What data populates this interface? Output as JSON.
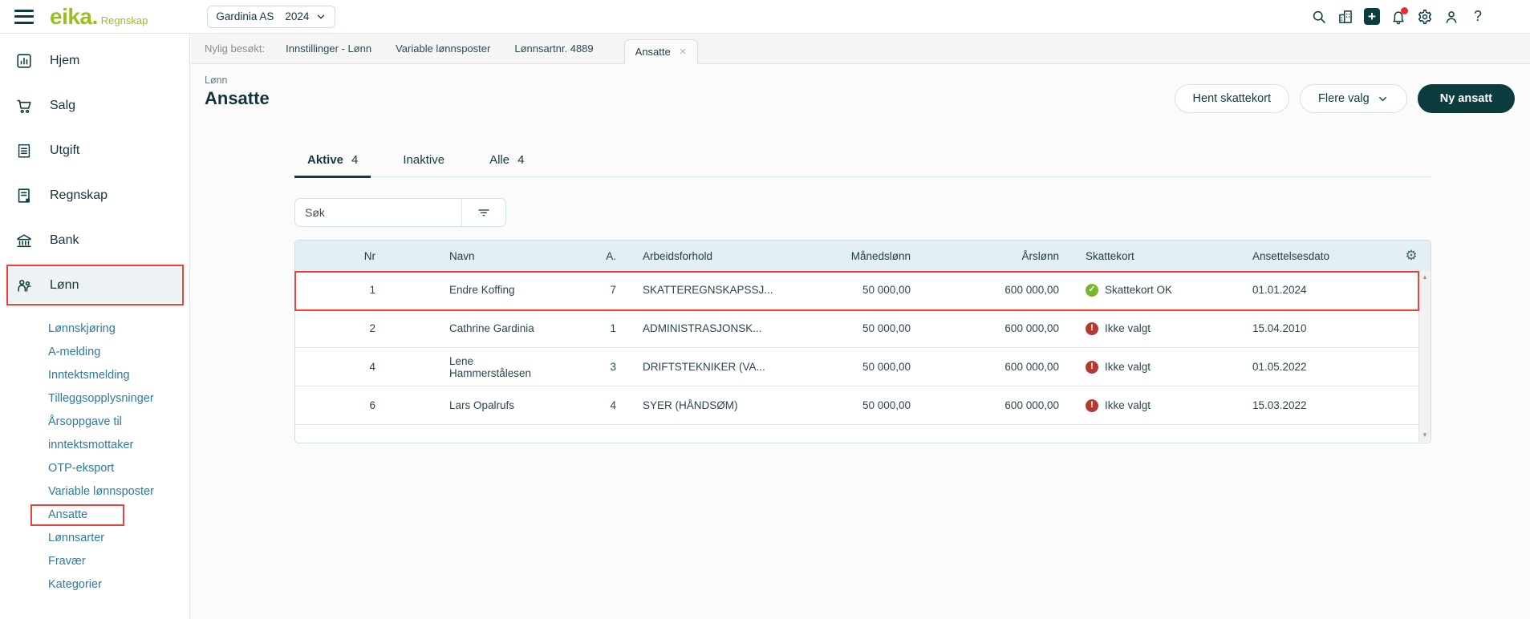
{
  "app": {
    "brand": "eika.",
    "brand_suffix": "Regnskap"
  },
  "topbar": {
    "company": "Gardinia AS",
    "year": "2024",
    "icons": [
      "search-icon",
      "buildings-icon",
      "add-icon",
      "bell-icon",
      "gear-icon",
      "user-icon",
      "help-icon"
    ],
    "help_glyph": "?",
    "has_notification": true
  },
  "sidebar": {
    "items": [
      {
        "label": "Hjem",
        "icon": "home-chart-icon",
        "active": false
      },
      {
        "label": "Salg",
        "icon": "cart-icon",
        "active": false
      },
      {
        "label": "Utgift",
        "icon": "receipt-icon",
        "active": false
      },
      {
        "label": "Regnskap",
        "icon": "ledger-icon",
        "active": false
      },
      {
        "label": "Bank",
        "icon": "bank-icon",
        "active": false
      },
      {
        "label": "Lønn",
        "icon": "people-icon",
        "active": true
      }
    ],
    "subitems": [
      "Lønnskjøring",
      "A-melding",
      "Inntektsmelding",
      "Tilleggsopplysninger",
      "Årsoppgave til inntektsmottaker",
      "OTP-eksport",
      "Variable lønnsposter",
      "Ansatte",
      "Lønnsarter",
      "Fravær",
      "Kategorier"
    ]
  },
  "recent": {
    "label": "Nylig besøkt:",
    "items": [
      "Innstillinger - Lønn",
      "Variable lønnsposter",
      "Lønnsartnr. 4889"
    ],
    "active_tab": "Ansatte",
    "close_glyph": "×"
  },
  "page": {
    "breadcrumb": "Lønn",
    "title": "Ansatte",
    "buttons": {
      "hent": "Hent skattekort",
      "flere": "Flere valg",
      "ny": "Ny ansatt"
    }
  },
  "tabs": [
    {
      "label": "Aktive",
      "count": "4",
      "active": true
    },
    {
      "label": "Inaktive",
      "count": "",
      "active": false
    },
    {
      "label": "Alle",
      "count": "4",
      "active": false
    }
  ],
  "search": {
    "placeholder": "Søk"
  },
  "table": {
    "columns": [
      "Nr",
      "Navn",
      "A.",
      "Arbeidsforhold",
      "Månedslønn",
      "Årslønn",
      "Skattekort",
      "Ansettelsesdato"
    ],
    "gear_glyph": "⚙",
    "scroll_up_glyph": "▲",
    "scroll_down_glyph": "▼",
    "rows": [
      {
        "nr": "1",
        "name": "Endre Koffing",
        "a": "7",
        "position": "SKATTEREGNSKAPSSJ...",
        "monthly": "50 000,00",
        "yearly": "600 000,00",
        "tax_status": "ok",
        "tax_glyph": "✓",
        "tax_label": "Skattekort OK",
        "hired": "01.01.2024",
        "highlighted": true
      },
      {
        "nr": "2",
        "name": "Cathrine Gardinia",
        "a": "1",
        "position": "ADMINISTRASJONSK...",
        "monthly": "50 000,00",
        "yearly": "600 000,00",
        "tax_status": "missing",
        "tax_glyph": "!",
        "tax_label": "Ikke valgt",
        "hired": "15.04.2010",
        "highlighted": false
      },
      {
        "nr": "4",
        "name": "Lene Hammerstålesen",
        "a": "3",
        "position": "DRIFTSTEKNIKER (VA...",
        "monthly": "50 000,00",
        "yearly": "600 000,00",
        "tax_status": "missing",
        "tax_glyph": "!",
        "tax_label": "Ikke valgt",
        "hired": "01.05.2022",
        "highlighted": false
      },
      {
        "nr": "6",
        "name": "Lars Opalrufs",
        "a": "4",
        "position": "SYER (HÅNDSØM)",
        "monthly": "50 000,00",
        "yearly": "600 000,00",
        "tax_status": "missing",
        "tax_glyph": "!",
        "tax_label": "Ikke valgt",
        "hired": "15.03.2022",
        "highlighted": false
      }
    ]
  },
  "colors": {
    "brand_green": "#95c11f",
    "dark_teal": "#0d3c3e",
    "link_blue": "#2e7ba0",
    "annotation_red": "#e8443c",
    "status_ok_green": "#76b82a",
    "status_missing_red": "#b23b31",
    "table_header_bg": "#e2eff5"
  }
}
